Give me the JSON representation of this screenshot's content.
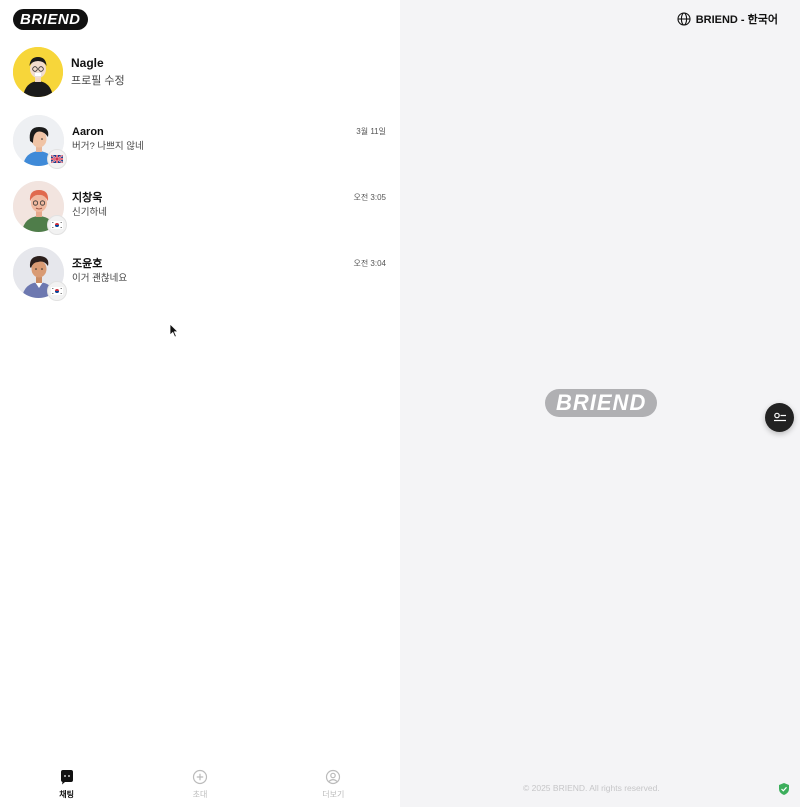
{
  "app": {
    "logo": "BRIEND"
  },
  "profile": {
    "name": "Nagle",
    "edit_label": "프로필 수정"
  },
  "chats": [
    {
      "name": "Aaron",
      "message": "버거? 나쁘지 않네",
      "time": "3월 11일",
      "flag": "uk-flag-icon"
    },
    {
      "name": "지창욱",
      "message": "신기하네",
      "time": "오전 3:05",
      "flag": "kr-flag-icon"
    },
    {
      "name": "조윤호",
      "message": "이거 괜찮네요",
      "time": "오전 3:04",
      "flag": "kr-flag-icon"
    }
  ],
  "nav": {
    "chat": "채팅",
    "invite": "초대",
    "more": "더보기"
  },
  "header": {
    "language_label": "BRIEND - 한국어"
  },
  "main": {
    "placeholder_logo": "BRIEND"
  },
  "footer": {
    "copyright": "© 2025 BRIEND. All rights reserved."
  },
  "colors": {
    "accent_dark": "#111111",
    "profile_avatar_bg": "#f7d63a",
    "shield_green": "#3cae5c"
  }
}
